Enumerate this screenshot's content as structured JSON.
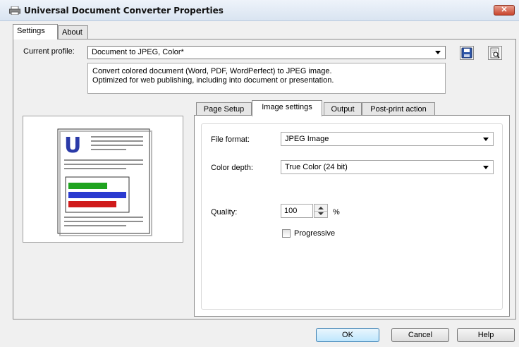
{
  "window": {
    "title": "Universal Document Converter Properties",
    "close_symbol": "✕"
  },
  "outer_tabs": [
    {
      "label": "Settings",
      "selected": true
    },
    {
      "label": "About",
      "selected": false
    }
  ],
  "profile": {
    "label": "Current profile:",
    "value": "Document to JPEG, Color*",
    "description_line1": "Convert colored document (Word, PDF, WordPerfect) to JPEG image.",
    "description_line2": "Optimized for web publishing, including into document or presentation."
  },
  "icons": {
    "save": "save-icon",
    "open": "open-profile-icon",
    "app": "printer-icon"
  },
  "inner_tabs": [
    {
      "label": "Page Setup",
      "selected": false
    },
    {
      "label": "Image settings",
      "selected": true
    },
    {
      "label": "Output",
      "selected": false
    },
    {
      "label": "Post-print action",
      "selected": false
    }
  ],
  "image_settings": {
    "file_format_label": "File format:",
    "file_format_value": "JPEG Image",
    "color_depth_label": "Color depth:",
    "color_depth_value": "True Color (24 bit)",
    "quality_label": "Quality:",
    "quality_value": "100",
    "quality_unit": "%",
    "progressive_label": "Progressive",
    "progressive_checked": false
  },
  "preview": {
    "letter": "U",
    "letter_color": "#2a3aa8",
    "bar_colors": [
      "#1fa31f",
      "#2a3ad0",
      "#d01b1b"
    ]
  },
  "buttons": {
    "ok": "OK",
    "cancel": "Cancel",
    "help": "Help"
  }
}
